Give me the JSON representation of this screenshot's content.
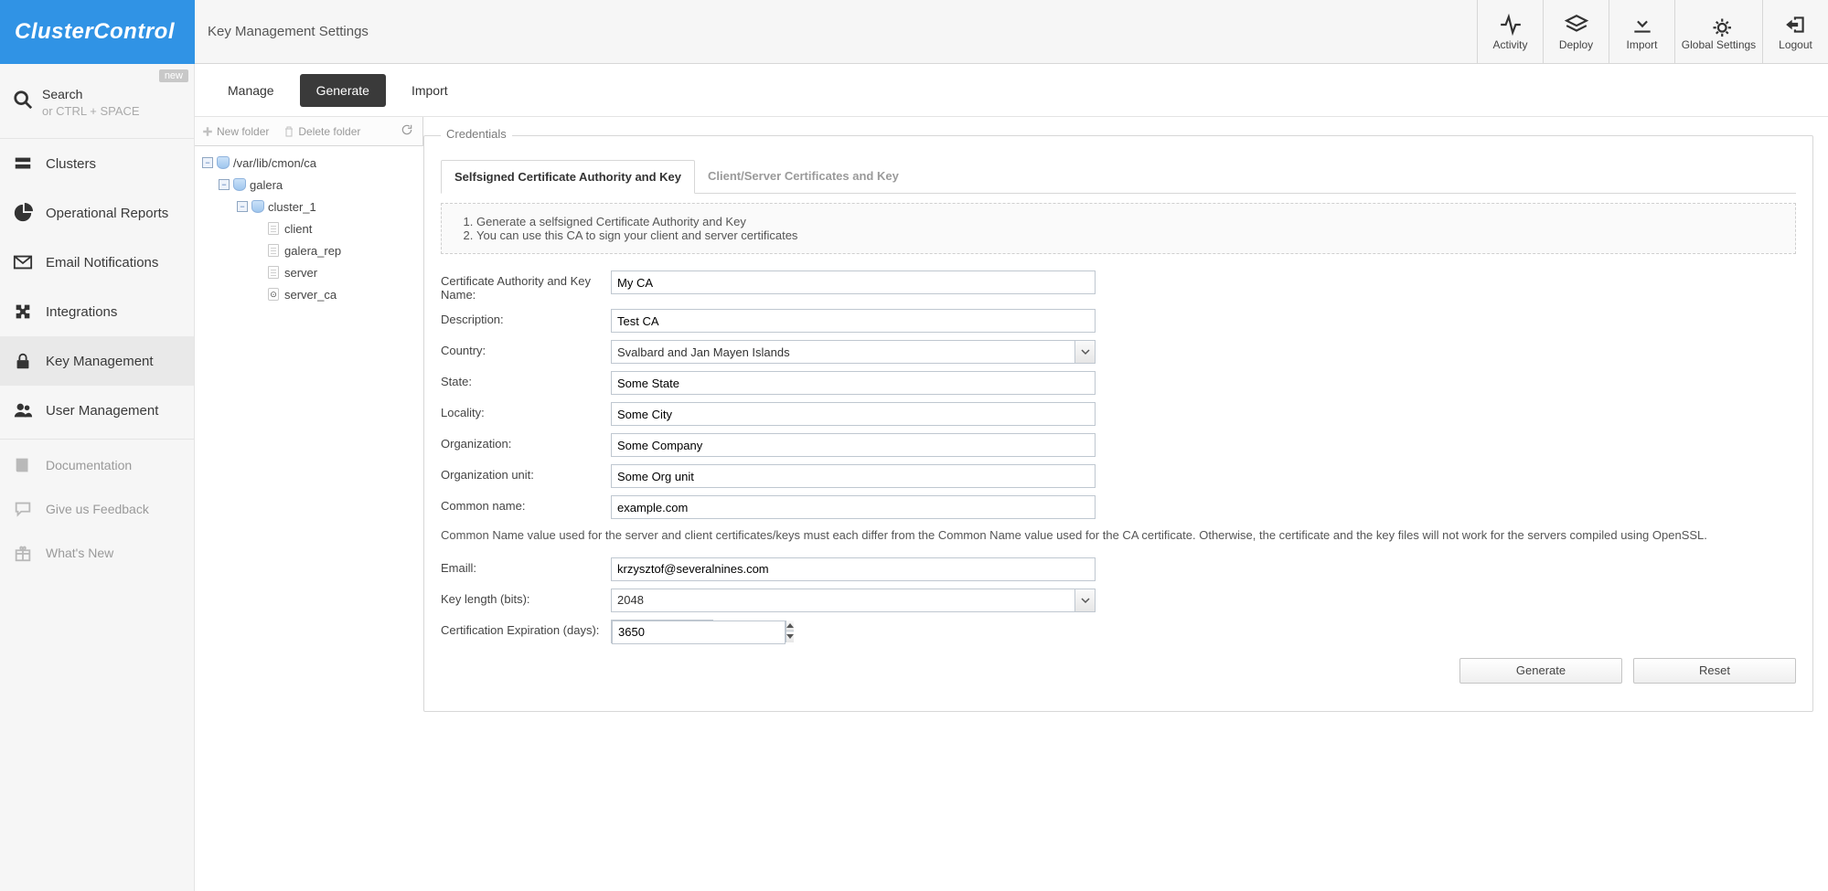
{
  "brand": "ClusterControl",
  "page_title": "Key Management Settings",
  "top_actions": {
    "activity": "Activity",
    "deploy": "Deploy",
    "import": "Import",
    "global_settings": "Global Settings",
    "logout": "Logout"
  },
  "search": {
    "badge": "new",
    "label": "Search",
    "hint": "or CTRL + SPACE"
  },
  "nav": {
    "clusters": "Clusters",
    "operational_reports": "Operational Reports",
    "email_notifications": "Email Notifications",
    "integrations": "Integrations",
    "key_management": "Key Management",
    "user_management": "User Management",
    "documentation": "Documentation",
    "feedback": "Give us Feedback",
    "whats_new": "What's New"
  },
  "subtabs": {
    "manage": "Manage",
    "generate": "Generate",
    "import": "Import"
  },
  "tree_toolbar": {
    "new_folder": "New folder",
    "delete_folder": "Delete folder"
  },
  "tree": {
    "root": "/var/lib/cmon/ca",
    "galera": "galera",
    "cluster": "cluster_1",
    "items": {
      "client": "client",
      "galera_rep": "galera_rep",
      "server": "server",
      "server_ca": "server_ca"
    }
  },
  "credentials": {
    "fieldset_title": "Credentials",
    "tab_self": "Selfsigned Certificate Authority and Key",
    "tab_cs": "Client/Server Certificates and Key",
    "note1": "Generate a selfsigned Certificate Authority and Key",
    "note2": "You can use this CA to sign your client and server certificates",
    "labels": {
      "ca_name": "Certificate Authority and Key Name:",
      "description": "Description:",
      "country": "Country:",
      "state": "State:",
      "locality": "Locality:",
      "organization": "Organization:",
      "org_unit": "Organization unit:",
      "common_name": "Common name:",
      "email": "Emaill:",
      "key_length": "Key length (bits):",
      "cert_exp": "Certification Expiration (days):"
    },
    "values": {
      "ca_name": "My CA",
      "description": "Test CA",
      "country": "Svalbard and Jan Mayen Islands",
      "state": "Some State",
      "locality": "Some City",
      "organization": "Some Company",
      "org_unit": "Some Org unit",
      "common_name": "example.com",
      "email": "krzysztof@severalnines.com",
      "key_length": "2048",
      "cert_exp": "3650"
    },
    "help_cn": "Common Name value used for the server and client certificates/keys must each differ from the Common Name value used for the CA certificate. Otherwise, the certificate and the key files will not work for the servers compiled using OpenSSL.",
    "buttons": {
      "generate": "Generate",
      "reset": "Reset"
    }
  }
}
